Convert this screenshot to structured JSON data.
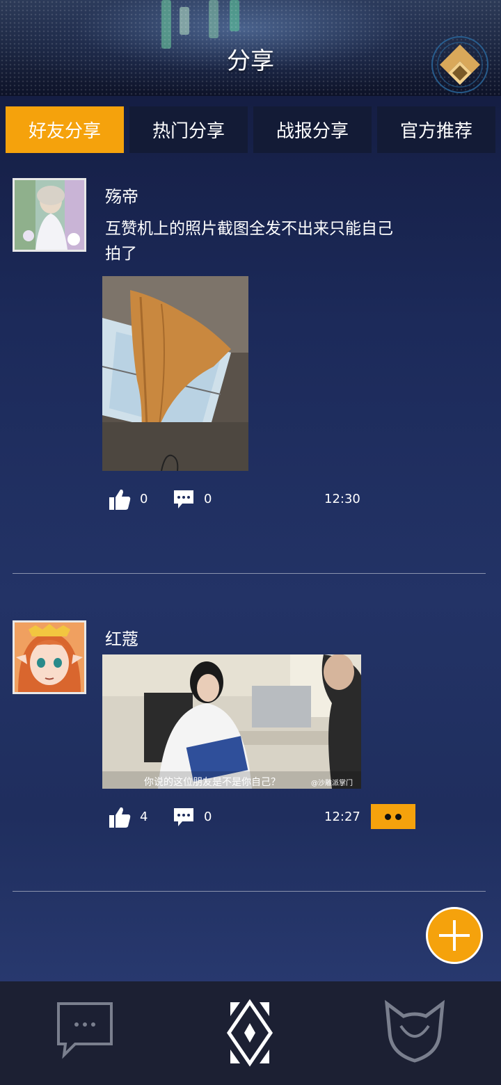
{
  "header": {
    "title": "分享",
    "home_icon": "home-diamond-icon"
  },
  "tabs": [
    {
      "label": "好友分享",
      "active": true
    },
    {
      "label": "热门分享",
      "active": false
    },
    {
      "label": "战报分享",
      "active": false
    },
    {
      "label": "官方推荐",
      "active": false
    }
  ],
  "posts": [
    {
      "username": "殇帝",
      "text_line1": "互赞机上的照片截图全发不出来只能自己",
      "text_line2": "拍了",
      "likes": "0",
      "comments": "0",
      "time": "12:30"
    },
    {
      "username": "红蔻",
      "image_caption": "你说的这位朋友是不是你自己？",
      "image_watermark": "@沙雕派掌门",
      "likes": "4",
      "comments": "0",
      "time": "12:27"
    }
  ],
  "fab": {
    "icon": "plus-icon"
  },
  "bottom_nav": [
    {
      "icon": "chat-icon"
    },
    {
      "icon": "diamond-emblem-icon"
    },
    {
      "icon": "cat-head-icon"
    }
  ],
  "colors": {
    "accent": "#f5a20c",
    "tab_bg": "#131b36",
    "nav_bg": "#1c2033"
  }
}
